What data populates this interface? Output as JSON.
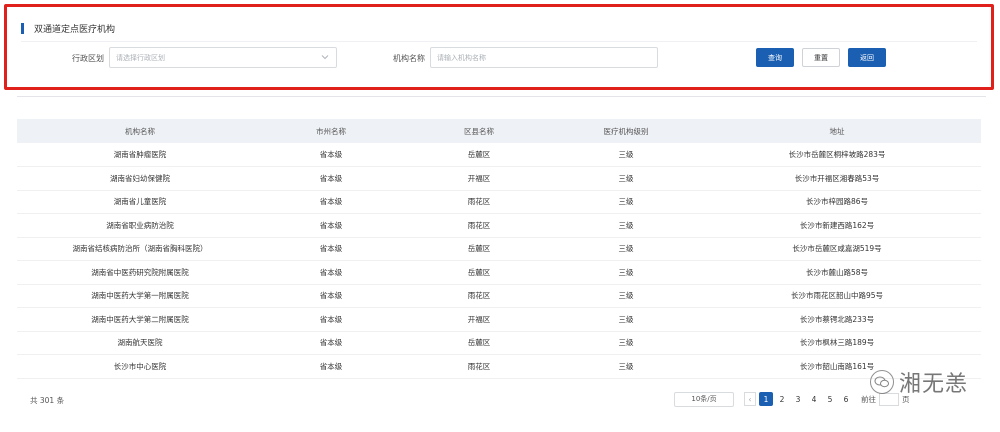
{
  "panel": {
    "title": "双通道定点医疗机构",
    "region_label": "行政区划",
    "region_placeholder": "请选择行政区划",
    "name_label": "机构名称",
    "name_placeholder": "请输入机构名称",
    "query_button": "查询",
    "reset_button": "重置",
    "back_button": "返回"
  },
  "table": {
    "headers": [
      "机构名称",
      "市州名称",
      "区县名称",
      "医疗机构级别",
      "地址"
    ],
    "rows": [
      [
        "湖南省肿瘤医院",
        "省本级",
        "岳麓区",
        "三级",
        "长沙市岳麓区桐梓坡路283号"
      ],
      [
        "湖南省妇幼保健院",
        "省本级",
        "开福区",
        "三级",
        "长沙市开福区湘春路53号"
      ],
      [
        "湖南省儿童医院",
        "省本级",
        "雨花区",
        "三级",
        "长沙市梓园路86号"
      ],
      [
        "湖南省职业病防治院",
        "省本级",
        "雨花区",
        "三级",
        "长沙市新建西路162号"
      ],
      [
        "湖南省结核病防治所（湖南省胸科医院）",
        "省本级",
        "岳麓区",
        "三级",
        "长沙市岳麓区咸嘉湖519号"
      ],
      [
        "湖南省中医药研究院附属医院",
        "省本级",
        "岳麓区",
        "三级",
        "长沙市麓山路58号"
      ],
      [
        "湖南中医药大学第一附属医院",
        "省本级",
        "雨花区",
        "三级",
        "长沙市雨花区韶山中路95号"
      ],
      [
        "湖南中医药大学第二附属医院",
        "省本级",
        "开福区",
        "三级",
        "长沙市蔡锷北路233号"
      ],
      [
        "湖南航天医院",
        "省本级",
        "岳麓区",
        "三级",
        "长沙市枫林三路189号"
      ],
      [
        "长沙市中心医院",
        "省本级",
        "雨花区",
        "三级",
        "长沙市韶山南路161号"
      ]
    ]
  },
  "footer": {
    "total": "共 301 条",
    "page_size": "10条/页",
    "pages": [
      "1",
      "2",
      "3",
      "4",
      "5",
      "6"
    ],
    "active_page": "1",
    "goto_label": "前往",
    "page_unit": "页"
  },
  "watermark": {
    "text": "湘无恙",
    "icon": "wechat-icon"
  },
  "colors": {
    "primary": "#1b5fb3",
    "highlight_border": "#e0201a",
    "header_bg": "#eef1f5"
  }
}
